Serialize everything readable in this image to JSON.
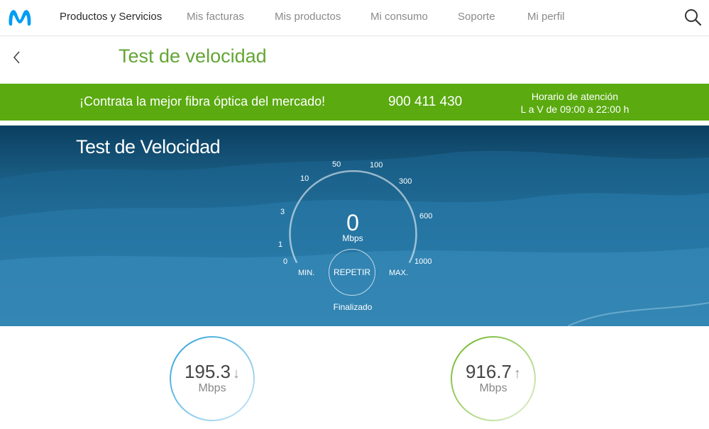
{
  "nav": {
    "items": [
      {
        "label": "Productos y Servicios"
      },
      {
        "label": "Mis facturas"
      },
      {
        "label": "Mis productos"
      },
      {
        "label": "Mi consumo"
      },
      {
        "label": "Soporte"
      },
      {
        "label": "Mi perfil"
      }
    ],
    "logo_icon": "movistar-m-logo",
    "search_icon": "search-icon"
  },
  "page": {
    "title": "Test de velocidad",
    "back_icon": "chevron-left-icon"
  },
  "promo": {
    "text": "¡Contrata la mejor fibra óptica del mercado!",
    "phone": "900 411 430",
    "hours_title": "Horario de atención",
    "hours_value": "L a V de 09:00 a 22:00 h"
  },
  "speedtest": {
    "title": "Test de Velocidad",
    "gauge_ticks": [
      "0",
      "1",
      "3",
      "10",
      "50",
      "100",
      "300",
      "600",
      "1000"
    ],
    "value": "0",
    "unit": "Mbps",
    "min_label": "MIN.",
    "max_label": "MAX.",
    "repeat_label": "REPETIR",
    "status": "Finalizado"
  },
  "results": {
    "download": {
      "value": "195.3",
      "unit": "Mbps",
      "arrow": "↓",
      "color": "#2aa0da"
    },
    "upload": {
      "value": "916.7",
      "unit": "Mbps",
      "arrow": "↑",
      "color": "#6cb520"
    }
  },
  "colors": {
    "brand_blue": "#019df4",
    "title_green": "#63a535",
    "promo_green": "#5aaa10"
  }
}
